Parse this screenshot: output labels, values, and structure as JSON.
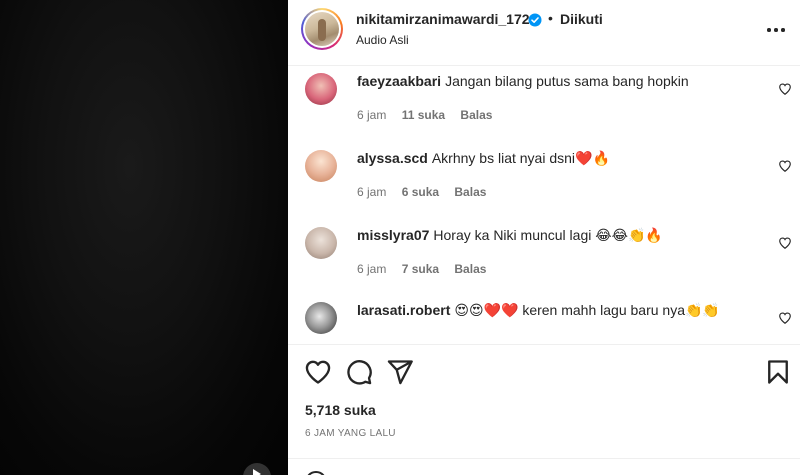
{
  "header": {
    "username": "nikitamirzanimawardi_172",
    "separator": "•",
    "follow_status": "Diikuti",
    "subtitle": "Audio Asli"
  },
  "comments": [
    {
      "username": "faeyzaakbari",
      "text": "Jangan bilang putus sama bang hopkin",
      "time": "6 jam",
      "likes": "11 suka",
      "reply": "Balas",
      "avatar_color": "#d9667a"
    },
    {
      "username": "alyssa.scd",
      "text": "Akrhny bs liat nyai dsni❤️🔥",
      "time": "6 jam",
      "likes": "6 suka",
      "reply": "Balas",
      "avatar_color": "#e8b49a"
    },
    {
      "username": "misslyra07",
      "text": "Horay ka Niki muncul lagi 😂😂👏🔥",
      "time": "6 jam",
      "likes": "7 suka",
      "reply": "Balas",
      "avatar_color": "#c9b6aa"
    },
    {
      "username": "larasati.robert",
      "text": "😍😍❤️❤️ keren mahh lagu baru nya👏👏",
      "time": "",
      "likes": "",
      "reply": "",
      "avatar_color": "#3a3a3a"
    }
  ],
  "actions": {
    "icons": [
      "heart-icon",
      "comment-icon",
      "share-icon",
      "bookmark-icon"
    ]
  },
  "likes_count": "5,718 suka",
  "posted_time": "6 JAM YANG LALU",
  "colors": {
    "text": "#262626",
    "muted": "#737373",
    "verified": "#0095f6",
    "divider": "#efefef"
  }
}
